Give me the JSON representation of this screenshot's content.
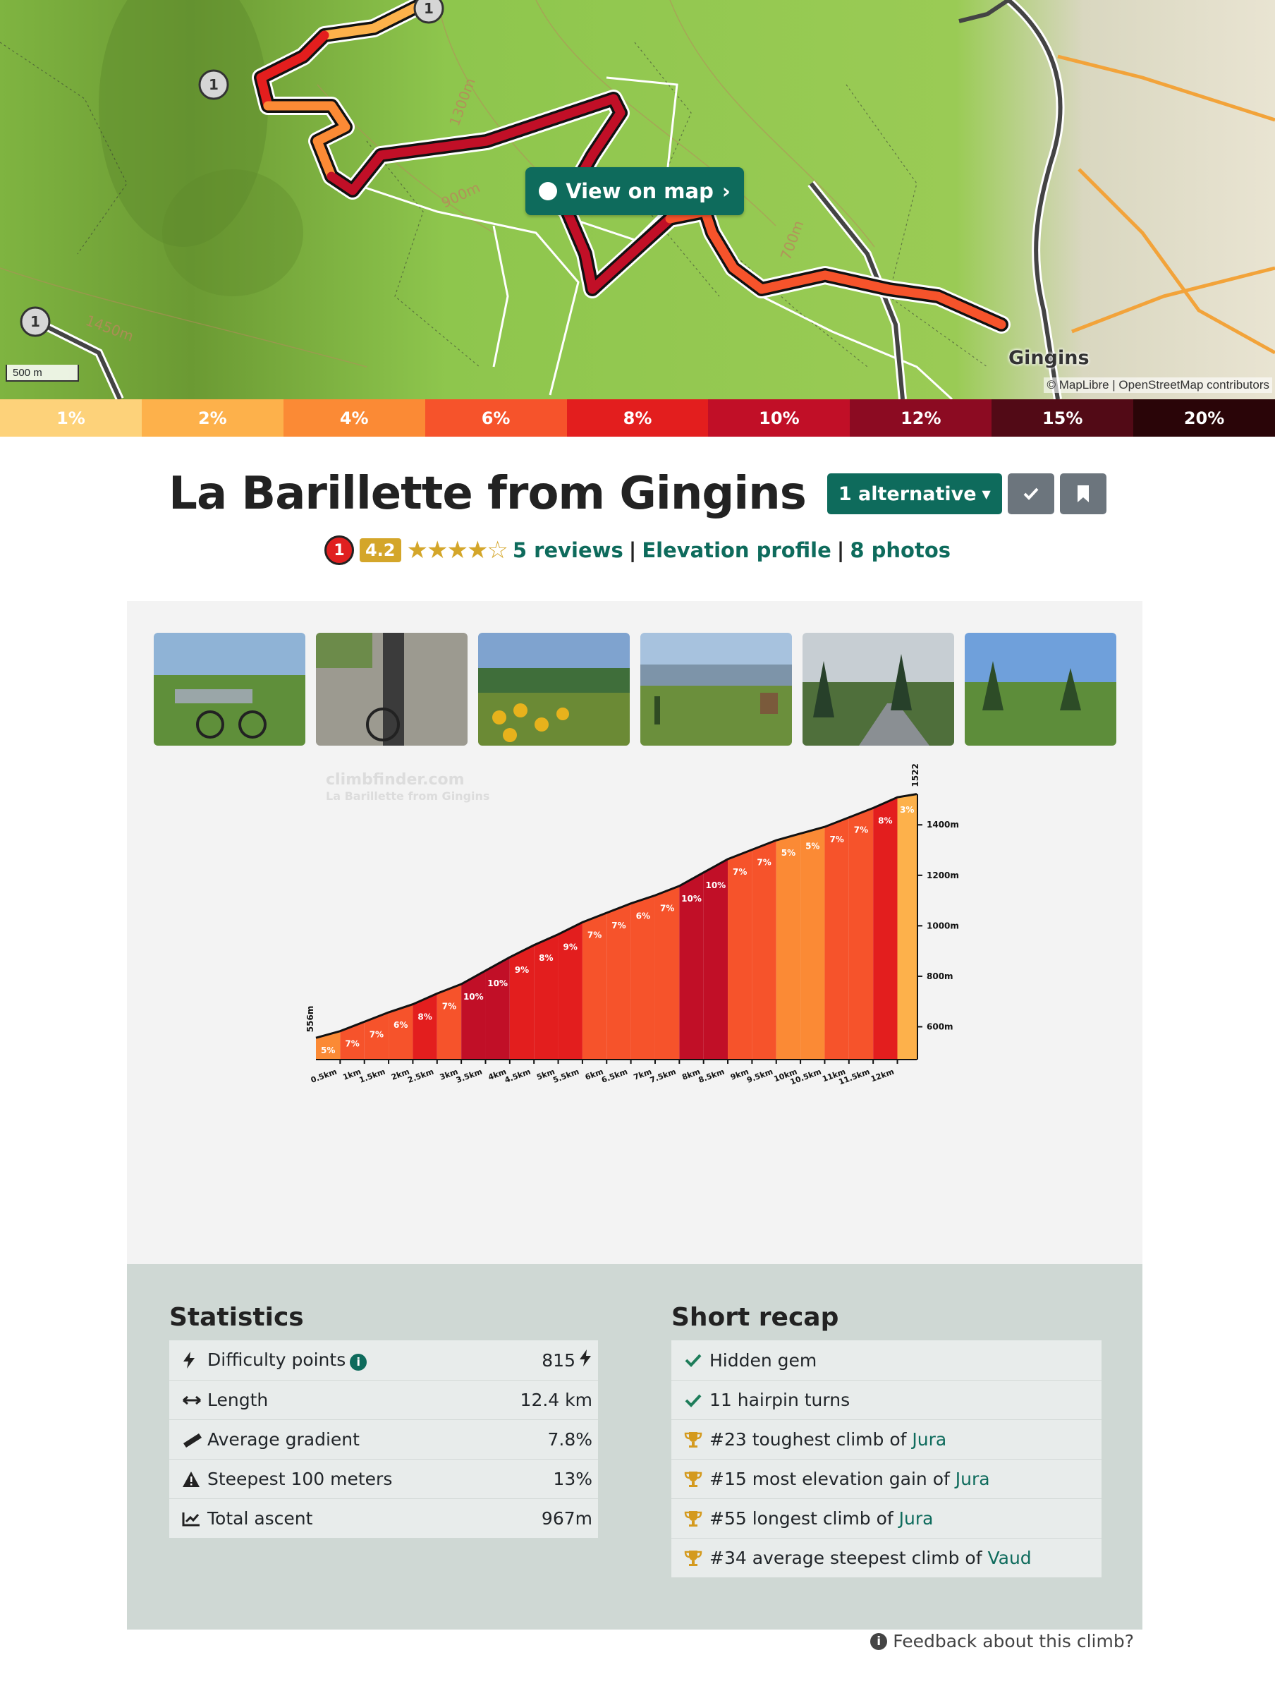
{
  "map": {
    "button_label": "View on map",
    "scale_label": "500 m",
    "town_label": "Gingins",
    "attribution": "© MapLibre | OpenStreetMap contributors",
    "contour_labels": [
      "1450m",
      "1300m",
      "900m",
      "700m",
      "1450m"
    ],
    "marker_label": "1"
  },
  "gradient_legend": [
    {
      "label": "1%",
      "color": "#fdd27a"
    },
    {
      "label": "2%",
      "color": "#fdb14b"
    },
    {
      "label": "4%",
      "color": "#fb8a35"
    },
    {
      "label": "6%",
      "color": "#f6532b"
    },
    {
      "label": "8%",
      "color": "#e31e1e"
    },
    {
      "label": "10%",
      "color": "#c10f27"
    },
    {
      "label": "12%",
      "color": "#8c0b22"
    },
    {
      "label": "15%",
      "color": "#520a16"
    },
    {
      "label": "20%",
      "color": "#2a0508"
    }
  ],
  "climb": {
    "title": "La Barillette from Gingins",
    "alternative_label": "1 alternative",
    "category": "1",
    "rating": "4.2",
    "stars": "★★★★☆",
    "reviews_label": "5 reviews",
    "elevation_profile_label": "Elevation profile",
    "photos_label": "8 photos",
    "separator": "|"
  },
  "chart_data": {
    "type": "area",
    "watermark": "climbfinder.com",
    "watermark_sub": "La Barillette from Gingins",
    "x_unit": "km",
    "x_ticks": [
      "0.5km",
      "1km",
      "1.5km",
      "2km",
      "2.5km",
      "3km",
      "3.5km",
      "4km",
      "4.5km",
      "5km",
      "5.5km",
      "6km",
      "6.5km",
      "7km",
      "7.5km",
      "8km",
      "8.5km",
      "9km",
      "9.5km",
      "10km",
      "10.5km",
      "11km",
      "11.5km",
      "12km"
    ],
    "y_ticks": [
      "600m",
      "800m",
      "1000m",
      "1200m",
      "1400m"
    ],
    "start_label": "556m",
    "end_label": "1522m",
    "ylim": [
      470,
      1560
    ],
    "xlim": [
      0,
      12.4
    ],
    "segments": [
      {
        "start": 0,
        "end": 0.5,
        "gradient": "5%",
        "color": "#fb8a35"
      },
      {
        "start": 0.5,
        "end": 1.0,
        "gradient": "7%",
        "color": "#f6532b"
      },
      {
        "start": 1.0,
        "end": 1.5,
        "gradient": "7%",
        "color": "#f6532b"
      },
      {
        "start": 1.5,
        "end": 2.0,
        "gradient": "6%",
        "color": "#f6532b"
      },
      {
        "start": 2.0,
        "end": 2.5,
        "gradient": "8%",
        "color": "#e31e1e"
      },
      {
        "start": 2.5,
        "end": 3.0,
        "gradient": "7%",
        "color": "#f6532b"
      },
      {
        "start": 3.0,
        "end": 3.5,
        "gradient": "10%",
        "color": "#c10f27"
      },
      {
        "start": 3.5,
        "end": 4.0,
        "gradient": "10%",
        "color": "#c10f27"
      },
      {
        "start": 4.0,
        "end": 4.5,
        "gradient": "9%",
        "color": "#e31e1e"
      },
      {
        "start": 4.5,
        "end": 5.0,
        "gradient": "8%",
        "color": "#e31e1e"
      },
      {
        "start": 5.0,
        "end": 5.5,
        "gradient": "9%",
        "color": "#e31e1e"
      },
      {
        "start": 5.5,
        "end": 6.0,
        "gradient": "7%",
        "color": "#f6532b"
      },
      {
        "start": 6.0,
        "end": 6.5,
        "gradient": "7%",
        "color": "#f6532b"
      },
      {
        "start": 6.5,
        "end": 7.0,
        "gradient": "6%",
        "color": "#f6532b"
      },
      {
        "start": 7.0,
        "end": 7.5,
        "gradient": "7%",
        "color": "#f6532b"
      },
      {
        "start": 7.5,
        "end": 8.0,
        "gradient": "10%",
        "color": "#c10f27"
      },
      {
        "start": 8.0,
        "end": 8.5,
        "gradient": "10%",
        "color": "#c10f27"
      },
      {
        "start": 8.5,
        "end": 9.0,
        "gradient": "7%",
        "color": "#f6532b"
      },
      {
        "start": 9.0,
        "end": 9.5,
        "gradient": "7%",
        "color": "#f6532b"
      },
      {
        "start": 9.5,
        "end": 10.0,
        "gradient": "5%",
        "color": "#fb8a35"
      },
      {
        "start": 10.0,
        "end": 10.5,
        "gradient": "5%",
        "color": "#fb8a35"
      },
      {
        "start": 10.5,
        "end": 11.0,
        "gradient": "7%",
        "color": "#f6532b"
      },
      {
        "start": 11.0,
        "end": 11.5,
        "gradient": "7%",
        "color": "#f6532b"
      },
      {
        "start": 11.5,
        "end": 12.0,
        "gradient": "8%",
        "color": "#e31e1e"
      },
      {
        "start": 12.0,
        "end": 12.4,
        "gradient": "3%",
        "color": "#fdb14b"
      }
    ],
    "elevation_start": 556,
    "elevation_end": 1522
  },
  "statistics": {
    "heading": "Statistics",
    "rows": [
      {
        "icon": "lightning-icon",
        "label": "Difficulty points",
        "value": "815"
      },
      {
        "icon": "arrows-horizontal-icon",
        "label": "Length",
        "value": "12.4 km"
      },
      {
        "icon": "ruler-icon",
        "label": "Average gradient",
        "value": "7.8%"
      },
      {
        "icon": "warning-icon",
        "label": "Steepest 100 meters",
        "value": "13%"
      },
      {
        "icon": "chart-line-icon",
        "label": "Total ascent",
        "value": "967m"
      }
    ]
  },
  "recap": {
    "heading": "Short recap",
    "rows": [
      {
        "icon": "check-icon",
        "text": "Hidden gem",
        "link": ""
      },
      {
        "icon": "check-icon",
        "text": "11 hairpin turns",
        "link": ""
      },
      {
        "icon": "trophy-icon",
        "text": "#23 toughest climb of ",
        "link": "Jura"
      },
      {
        "icon": "trophy-icon",
        "text": "#15 most elevation gain of ",
        "link": "Jura"
      },
      {
        "icon": "trophy-icon",
        "text": "#55 longest climb of ",
        "link": "Jura"
      },
      {
        "icon": "trophy-icon",
        "text": "#34 average steepest climb of ",
        "link": "Vaud"
      }
    ]
  },
  "feedback_label": "Feedback about this climb?",
  "colors": {
    "brand": "#0e6b5c",
    "star": "#d4a62a"
  }
}
